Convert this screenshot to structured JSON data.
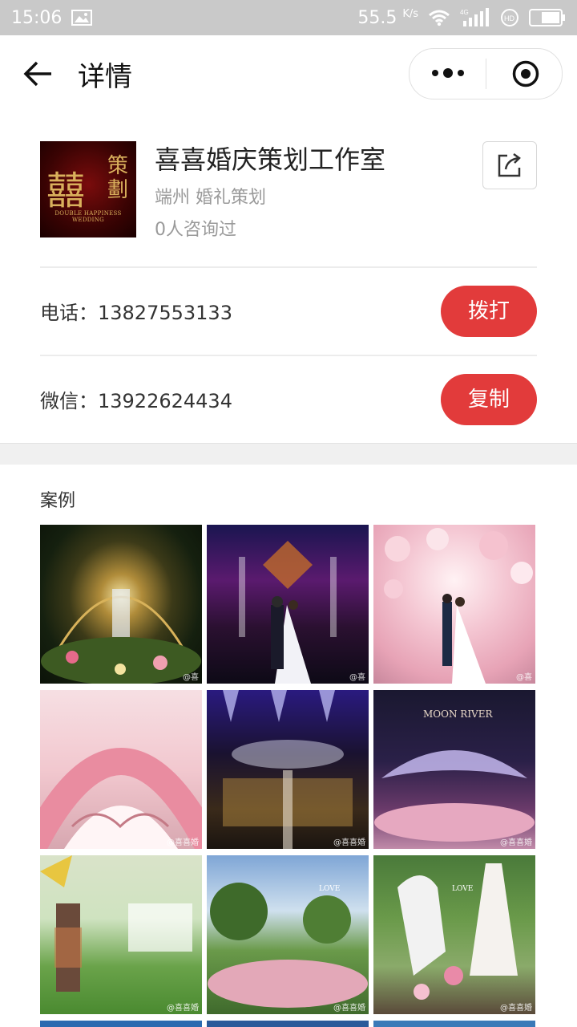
{
  "status_bar": {
    "time": "15:06",
    "speed": "55.5",
    "speed_unit": "K/s",
    "network": "4G"
  },
  "nav": {
    "title": "详情"
  },
  "shop": {
    "name": "喜喜婚庆策划工作室",
    "location": "端州 婚礼策划",
    "consult_count": "0人咨询过",
    "logo_main": "囍",
    "logo_side": "策劃",
    "logo_sub": "DOUBLE HAPPINESS WEDDING"
  },
  "phone": {
    "label": "电话：13827553133",
    "button": "拨打"
  },
  "wechat": {
    "label": "微信：13922624434",
    "button": "复制"
  },
  "cases": {
    "title": "案例",
    "items": [
      {
        "watermark": "@喜",
        "theme": "gold-garden-night"
      },
      {
        "watermark": "@喜",
        "theme": "purple-stage-couple"
      },
      {
        "watermark": "@喜",
        "theme": "pink-balloon-couple"
      },
      {
        "watermark": "@喜喜婚",
        "theme": "pink-flower-arch"
      },
      {
        "watermark": "@喜喜婚",
        "theme": "blue-light-stage"
      },
      {
        "watermark": "@喜喜婚",
        "theme": "moon-river-stage"
      },
      {
        "watermark": "@喜喜婚",
        "theme": "green-lawn-lantern"
      },
      {
        "watermark": "@喜喜婚",
        "theme": "outdoor-garden"
      },
      {
        "watermark": "@喜喜婚",
        "theme": "white-horse-garden"
      }
    ]
  }
}
